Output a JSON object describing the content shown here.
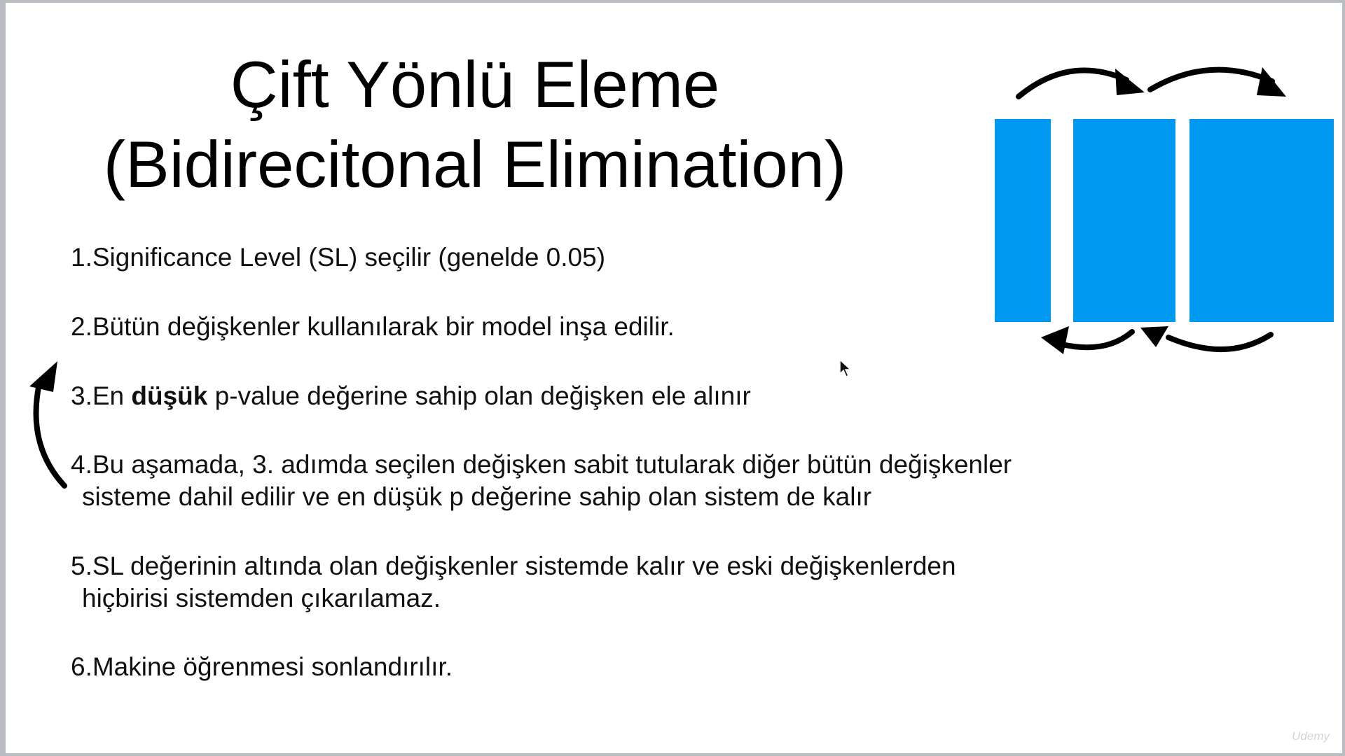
{
  "slide": {
    "title_line_1": "Çift Yönlü Eleme",
    "title_line_2": "(Bidirecitonal Elimination)",
    "steps": [
      {
        "text": "1.Significance Level (SL) seçilir (genelde 0.05)"
      },
      {
        "text": "2.Bütün değişkenler kullanılarak bir model inşa edilir."
      },
      {
        "prefix": "3.En ",
        "bold": "düşük",
        "suffix": " p-value değerine sahip olan değişken ele alınır"
      },
      {
        "line1": "4.Bu aşamada, 3. adımda seçilen değişken sabit tutularak diğer bütün değişkenler",
        "line2": "sisteme dahil edilir ve en düşük p değerine sahip olan sistem de kalır"
      },
      {
        "line1": "5.SL değerinin altında olan değişkenler sistemde kalır ve eski değişkenlerden",
        "line2": "hiçbirisi sistemden çıkarılamaz."
      },
      {
        "text": "6.Makine öğrenmesi sonlandırılır."
      }
    ],
    "watermark": "Udemy"
  },
  "diagram": {
    "block_color": "#0099f2",
    "arrow_color": "#000000",
    "icons": [
      "arrow-right-icon",
      "arrow-left-icon",
      "curved-up-arrow-icon",
      "mouse-pointer-icon"
    ]
  }
}
